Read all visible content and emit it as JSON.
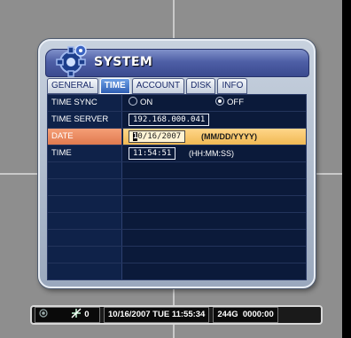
{
  "window": {
    "title": "SYSTEM"
  },
  "tabs": [
    {
      "label": "GENERAL",
      "active": false
    },
    {
      "label": "TIME",
      "active": true
    },
    {
      "label": "ACCOUNT",
      "active": false
    },
    {
      "label": "DISK",
      "active": false
    },
    {
      "label": "INFO",
      "active": false
    }
  ],
  "rows": {
    "time_sync": {
      "label": "TIME SYNC",
      "option_on": "ON",
      "option_off": "OFF",
      "selected": "OFF"
    },
    "time_server": {
      "label": "TIME SERVER",
      "value": "192.168.000.041"
    },
    "date": {
      "label": "DATE",
      "cursor_char": "1",
      "value_rest": "0/16/2007",
      "format": "(MM/DD/YYYY)"
    },
    "time": {
      "label": "TIME",
      "value": "11:54:51",
      "format": "(HH:MM:SS)"
    }
  },
  "statusbar": {
    "channel_icon": "record-dot-icon",
    "network_icon": "network-off-icon",
    "count": "0",
    "datetime": "10/16/2007 TUE 11:55:34",
    "disk": "244G",
    "clock": "0000:00"
  },
  "colors": {
    "background": "#8e8e8e",
    "title_bar": "#4e5fa6",
    "table_bg": "#0b1a3a",
    "highlight_label": "#e8875a",
    "highlight_value": "#f5c56a",
    "active_tab": "#2f5fb3"
  }
}
